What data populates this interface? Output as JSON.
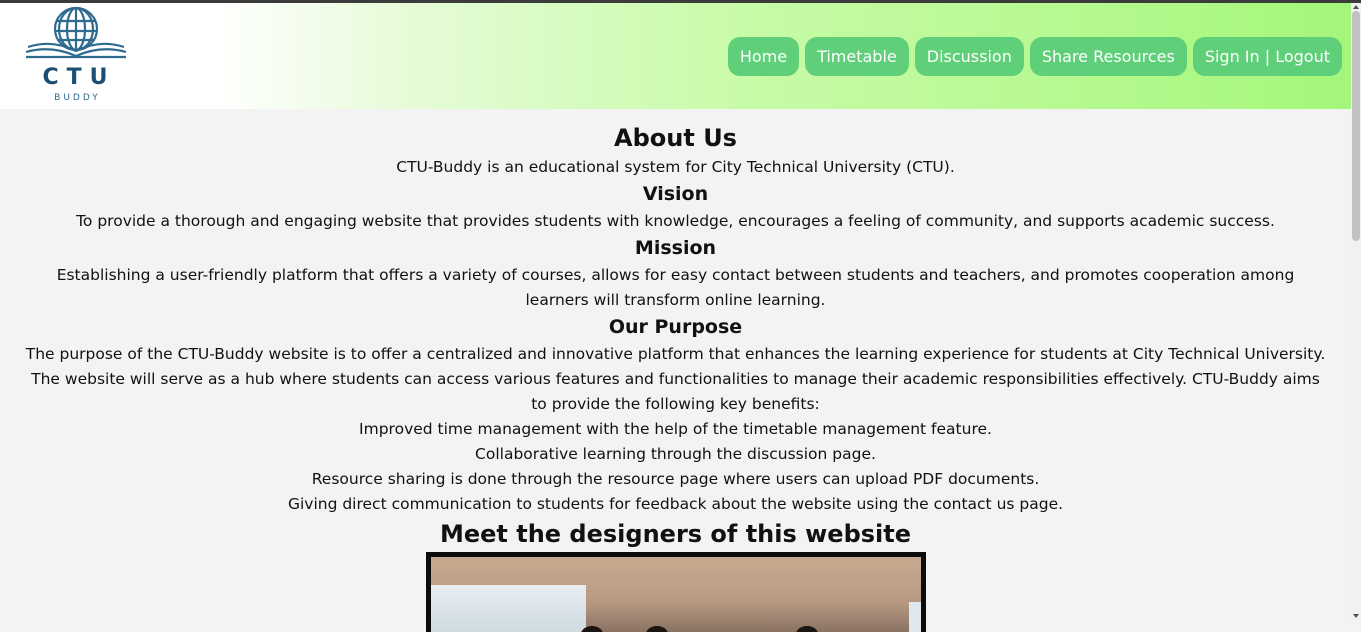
{
  "header": {
    "logo": {
      "title": "CTU",
      "subtitle": "BUDDY",
      "icon": "globe-book-icon"
    },
    "nav": [
      {
        "label": "Home"
      },
      {
        "label": "Timetable"
      },
      {
        "label": "Discussion"
      },
      {
        "label": "Share Resources"
      },
      {
        "label": "Sign In | Logout"
      }
    ]
  },
  "about": {
    "title": "About Us",
    "intro": "CTU-Buddy is an educational system for City Technical University (CTU).",
    "vision_heading": "Vision",
    "vision_text": "To provide a thorough and engaging website that provides students with knowledge, encourages a feeling of community, and supports academic success.",
    "mission_heading": "Mission",
    "mission_text_1": "Establishing a user-friendly platform that offers a variety of courses, allows for easy contact between students and teachers, and promotes cooperation among",
    "mission_text_2": "learners will transform online learning.",
    "purpose_heading": "Our Purpose",
    "purpose_text_1": "The purpose of the CTU-Buddy website is to offer a centralized and innovative platform that enhances the learning experience for students at City Technical University.",
    "purpose_text_2": "The website will serve as a hub where students can access various features and functionalities to manage their academic responsibilities effectively. CTU-Buddy aims",
    "purpose_text_3": "to provide the following key benefits:",
    "benefits": [
      "Improved time management with the help of the timetable management feature.",
      "Collaborative learning through the discussion page.",
      "Resource sharing is done through the resource page where users can upload PDF documents.",
      "Giving direct communication to students for feedback about the website using the contact us page."
    ],
    "designers_heading": "Meet the designers of this website"
  },
  "colors": {
    "nav_button": "#5fcf79",
    "header_gradient_end": "#a4f67a",
    "logo_blue": "#1c4f73",
    "page_background": "#f3f3f3"
  }
}
